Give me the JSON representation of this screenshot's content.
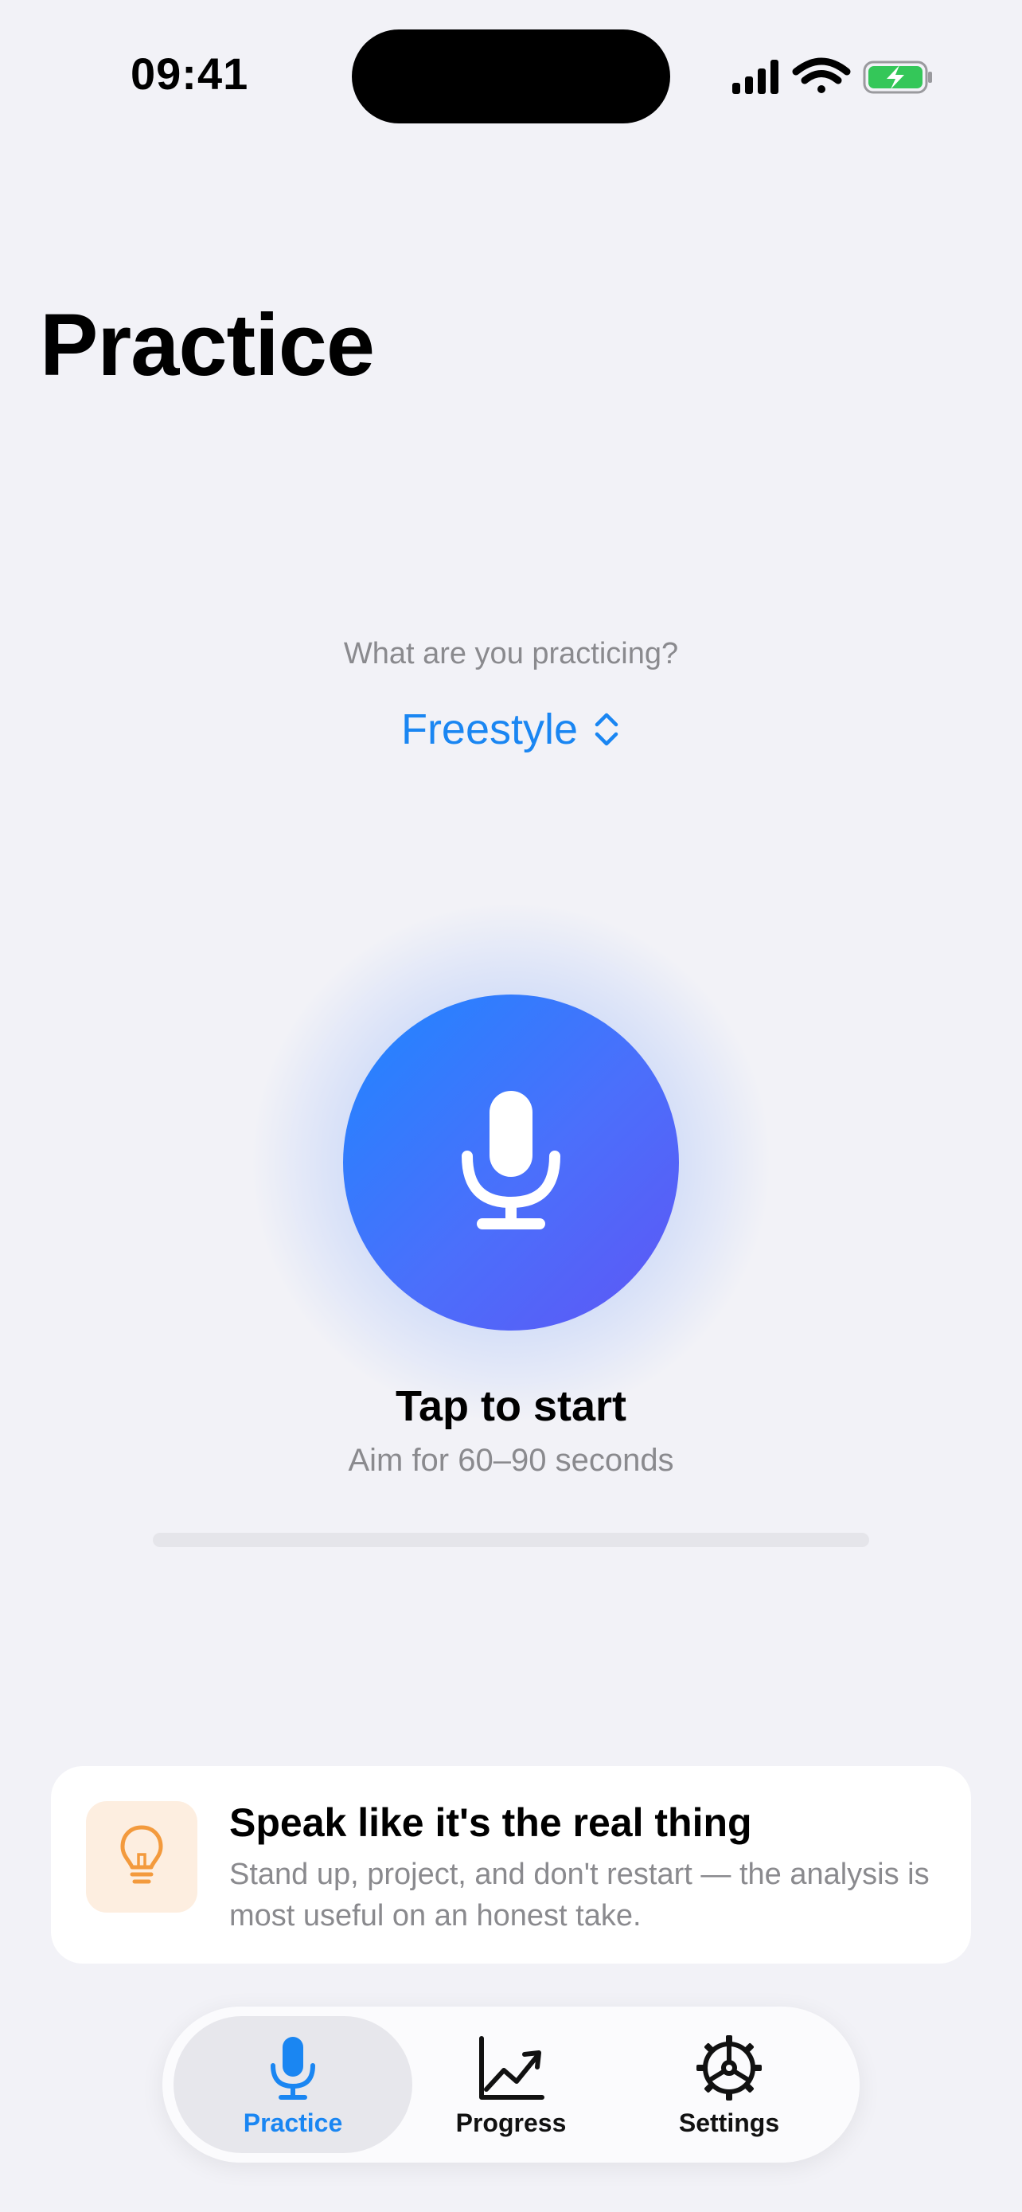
{
  "status_bar": {
    "time": "09:41"
  },
  "header": {
    "title": "Practice"
  },
  "prompt": {
    "question": "What are you practicing?",
    "selected_mode": "Freestyle"
  },
  "recorder": {
    "primary_label": "Tap to start",
    "secondary_label": "Aim for 60–90 seconds",
    "progress_fraction": 0
  },
  "tip": {
    "title": "Speak like it's the real thing",
    "body": "Stand up, project, and don't restart — the analysis is most useful on an honest take.",
    "icon": "lightbulb-icon"
  },
  "tabs": [
    {
      "label": "Practice",
      "icon": "microphone-icon",
      "active": true
    },
    {
      "label": "Progress",
      "icon": "chart-line-icon",
      "active": false
    },
    {
      "label": "Settings",
      "icon": "gear-icon",
      "active": false
    }
  ],
  "colors": {
    "accent": "#1a86f2",
    "mic_gradient_start": "#1f86ff",
    "mic_gradient_end": "#5e56f5",
    "tip_icon": "#f39a3d",
    "battery": "#34c759"
  }
}
